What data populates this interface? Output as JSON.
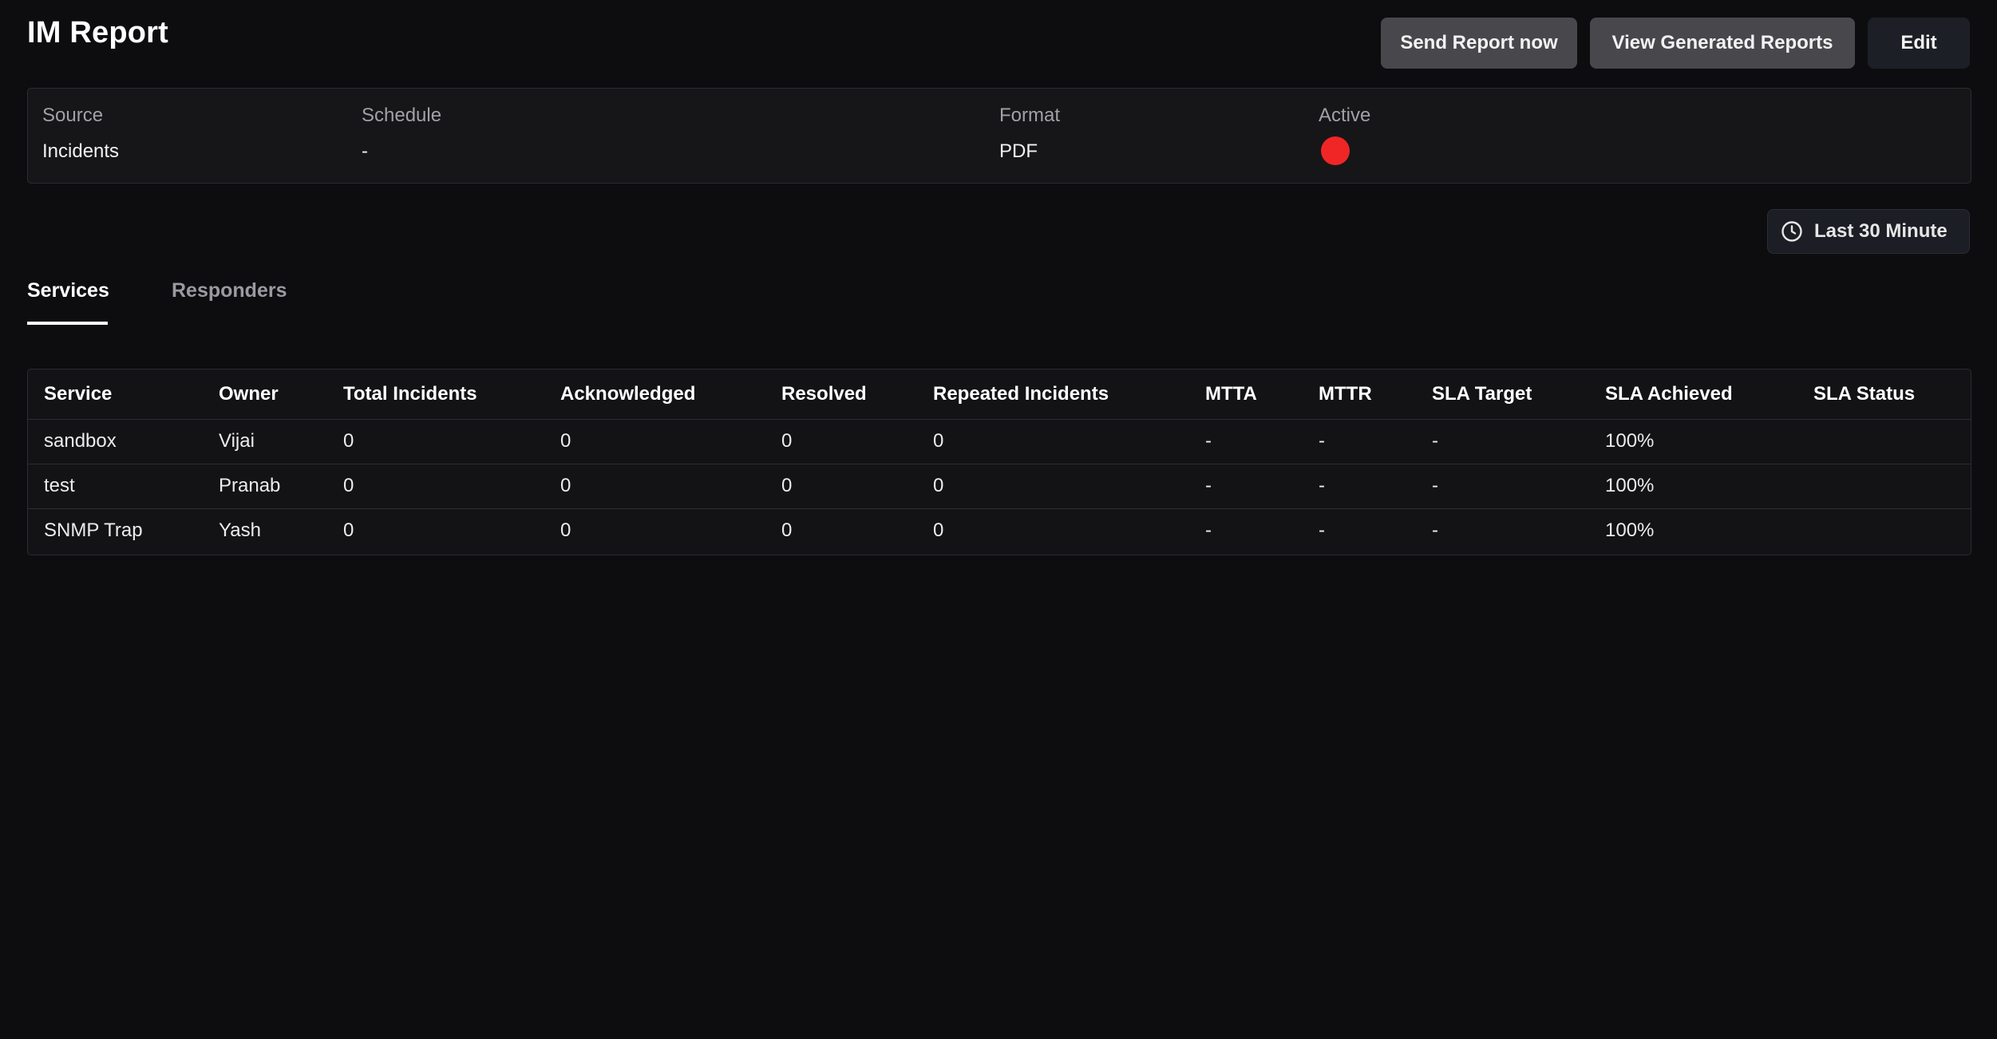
{
  "page": {
    "title": "IM Report",
    "actions": {
      "send_now": "Send Report now",
      "view_generated": "View Generated Reports",
      "edit": "Edit"
    }
  },
  "summary": {
    "source_label": "Source",
    "source_value": "Incidents",
    "schedule_label": "Schedule",
    "schedule_value": "-",
    "format_label": "Format",
    "format_value": "PDF",
    "active_label": "Active",
    "active_status_color": "#f02626"
  },
  "time_range": {
    "icon": "clock-icon",
    "label": "Last 30 Minute"
  },
  "tabs": [
    {
      "label": "Services",
      "active": true
    },
    {
      "label": "Responders",
      "active": false
    }
  ],
  "table": {
    "headers": [
      "Service",
      "Owner",
      "Total Incidents",
      "Acknowledged",
      "Resolved",
      "Repeated Incidents",
      "MTTA",
      "MTTR",
      "SLA Target",
      "SLA Achieved",
      "SLA Status"
    ],
    "rows": [
      [
        "sandbox",
        "Vijai",
        "0",
        "0",
        "0",
        "0",
        "-",
        "-",
        "-",
        "100%",
        ""
      ],
      [
        "test",
        "Pranab",
        "0",
        "0",
        "0",
        "0",
        "-",
        "-",
        "-",
        "100%",
        ""
      ],
      [
        "SNMP Trap",
        "Yash",
        "0",
        "0",
        "0",
        "0",
        "-",
        "-",
        "-",
        "100%",
        ""
      ]
    ]
  }
}
